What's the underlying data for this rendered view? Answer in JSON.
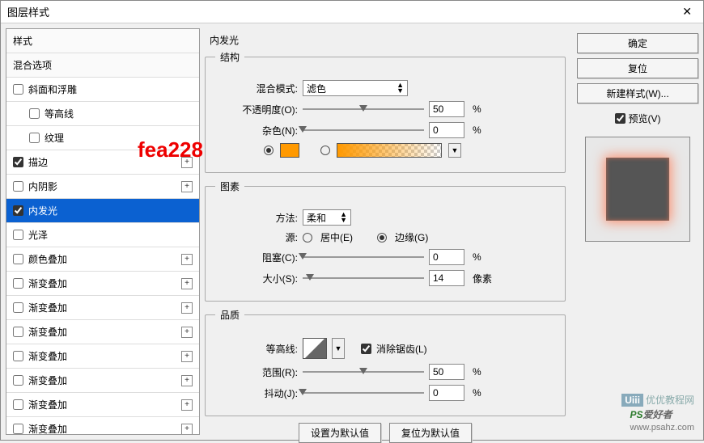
{
  "window": {
    "title": "图层样式"
  },
  "sidebar": {
    "items": [
      {
        "label": "样式",
        "type": "header"
      },
      {
        "label": "混合选项",
        "type": "header"
      },
      {
        "label": "斜面和浮雕",
        "type": "check",
        "checked": false
      },
      {
        "label": "等高线",
        "type": "sub",
        "checked": false
      },
      {
        "label": "纹理",
        "type": "sub",
        "checked": false
      },
      {
        "label": "描边",
        "type": "check",
        "checked": true,
        "plus": true
      },
      {
        "label": "内阴影",
        "type": "check",
        "checked": false,
        "plus": true
      },
      {
        "label": "内发光",
        "type": "check",
        "checked": true,
        "selected": true
      },
      {
        "label": "光泽",
        "type": "check",
        "checked": false
      },
      {
        "label": "颜色叠加",
        "type": "check",
        "checked": false,
        "plus": true
      },
      {
        "label": "渐变叠加",
        "type": "check",
        "checked": false,
        "plus": true
      },
      {
        "label": "渐变叠加",
        "type": "check",
        "checked": false,
        "plus": true
      },
      {
        "label": "渐变叠加",
        "type": "check",
        "checked": false,
        "plus": true
      },
      {
        "label": "渐变叠加",
        "type": "check",
        "checked": false,
        "plus": true
      },
      {
        "label": "渐变叠加",
        "type": "check",
        "checked": false,
        "plus": true
      },
      {
        "label": "渐变叠加",
        "type": "check",
        "checked": false,
        "plus": true
      },
      {
        "label": "渐变叠加",
        "type": "check",
        "checked": false,
        "plus": true
      }
    ]
  },
  "panel": {
    "title": "内发光",
    "structure": {
      "legend": "结构",
      "blend_label": "混合模式:",
      "blend_value": "滤色",
      "opacity_label": "不透明度(O):",
      "opacity_value": "50",
      "opacity_unit": "%",
      "noise_label": "杂色(N):",
      "noise_value": "0",
      "noise_unit": "%",
      "swatch_color": "#ff9900"
    },
    "elements": {
      "legend": "图素",
      "method_label": "方法:",
      "method_value": "柔和",
      "source_label": "源:",
      "source_center": "居中(E)",
      "source_edge": "边缘(G)",
      "choke_label": "阻塞(C):",
      "choke_value": "0",
      "choke_unit": "%",
      "size_label": "大小(S):",
      "size_value": "14",
      "size_unit": "像素"
    },
    "quality": {
      "legend": "品质",
      "contour_label": "等高线:",
      "aa_label": "消除锯齿(L)",
      "range_label": "范围(R):",
      "range_value": "50",
      "range_unit": "%",
      "jitter_label": "抖动(J):",
      "jitter_value": "0",
      "jitter_unit": "%"
    },
    "buttons": {
      "make_default": "设置为默认值",
      "reset_default": "复位为默认值"
    }
  },
  "right": {
    "ok": "确定",
    "cancel": "复位",
    "new_style": "新建样式(W)...",
    "preview": "预览(V)"
  },
  "watermarks": {
    "red": "fea228",
    "br1": "优优教程网",
    "br2a": "PS",
    "br2b": "爱好者",
    "br2c": "www.psahz.com"
  }
}
